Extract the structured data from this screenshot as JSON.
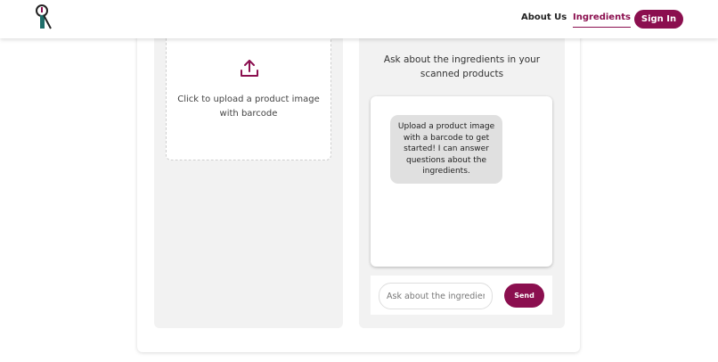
{
  "header": {
    "logo_icon": "ingredient-scanner-logo",
    "nav": [
      {
        "label": "About Us"
      },
      {
        "label": "Ingredients",
        "active": true
      }
    ],
    "sign_in_label": "Sign In"
  },
  "upload": {
    "icon": "upload-icon",
    "text": "Click to upload a product image with barcode"
  },
  "chat": {
    "subtitle": "Ask about the ingredients in your scanned products",
    "messages": [
      {
        "sender": "bot",
        "text": "Upload a product image with a barcode to get started! I can answer questions about the ingredients."
      }
    ],
    "input": {
      "value": "",
      "placeholder": "Ask about the ingredients..."
    },
    "send_label": "Send"
  },
  "colors": {
    "brand": "#8b0f4f",
    "panel_bg": "#f2f2f2",
    "bubble_bg": "#e0e0e0"
  }
}
